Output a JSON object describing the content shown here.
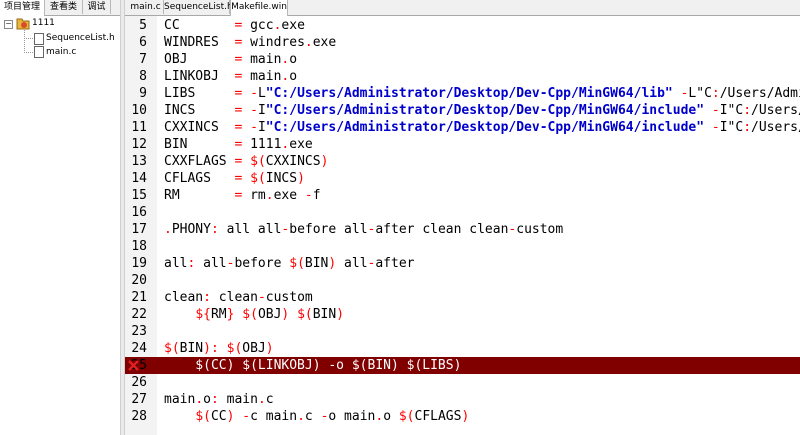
{
  "left_tabs": [
    "项目管理",
    "查看类",
    "调试"
  ],
  "project_tree": {
    "project": "1111",
    "collapse_symbol": "⊟",
    "files": [
      "SequenceList.h",
      "main.c"
    ]
  },
  "editor_tabs": [
    {
      "label": "main.c",
      "active": false
    },
    {
      "label": "SequenceList.h",
      "active": false
    },
    {
      "label": "Makefile.win",
      "active": true
    }
  ],
  "highlighted_line": 25,
  "lines": [
    {
      "n": "5",
      "text": "CC       = gcc.exe"
    },
    {
      "n": "6",
      "text": "WINDRES  = windres.exe"
    },
    {
      "n": "7",
      "text": "OBJ      = main.o"
    },
    {
      "n": "8",
      "text": "LINKOBJ  = main.o"
    },
    {
      "n": "9",
      "text": "LIBS     = -L\"C:/Users/Administrator/Desktop/Dev-Cpp/MinGW64/lib\" -L\"C:/Users/Admin"
    },
    {
      "n": "10",
      "text": "INCS     = -I\"C:/Users/Administrator/Desktop/Dev-Cpp/MinGW64/include\" -I\"C:/Users/A"
    },
    {
      "n": "11",
      "text": "CXXINCS  = -I\"C:/Users/Administrator/Desktop/Dev-Cpp/MinGW64/include\" -I\"C:/Users/A"
    },
    {
      "n": "12",
      "text": "BIN      = 1111.exe"
    },
    {
      "n": "13",
      "text": "CXXFLAGS = $(CXXINCS)"
    },
    {
      "n": "14",
      "text": "CFLAGS   = $(INCS)"
    },
    {
      "n": "15",
      "text": "RM       = rm.exe -f"
    },
    {
      "n": "16",
      "text": ""
    },
    {
      "n": "17",
      "text": ".PHONY: all all-before all-after clean clean-custom"
    },
    {
      "n": "18",
      "text": ""
    },
    {
      "n": "19",
      "text": "all: all-before $(BIN) all-after"
    },
    {
      "n": "20",
      "text": ""
    },
    {
      "n": "21",
      "text": "clean: clean-custom"
    },
    {
      "n": "22",
      "text": "    ${RM} $(OBJ) $(BIN)"
    },
    {
      "n": "23",
      "text": ""
    },
    {
      "n": "24",
      "text": "$(BIN): $(OBJ)"
    },
    {
      "n": "25",
      "text": "    $(CC) $(LINKOBJ) -o $(BIN) $(LIBS)"
    },
    {
      "n": "26",
      "text": ""
    },
    {
      "n": "27",
      "text": "main.o: main.c"
    },
    {
      "n": "28",
      "text": "    $(CC) -c main.c -o main.o $(CFLAGS)"
    }
  ],
  "colors": {
    "highlight_bg": "#800000",
    "string": "#0000cc",
    "operator": "#ff0000",
    "gutter_bg": "#f3f3f3"
  }
}
